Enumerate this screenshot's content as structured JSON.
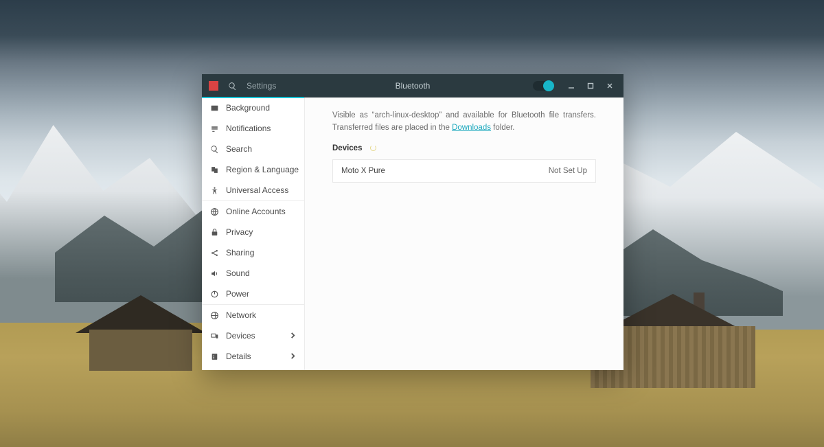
{
  "titlebar": {
    "app_title": "Settings",
    "panel_title": "Bluetooth"
  },
  "sidebar": {
    "items": [
      {
        "label": "Background"
      },
      {
        "label": "Notifications"
      },
      {
        "label": "Search"
      },
      {
        "label": "Region & Language"
      },
      {
        "label": "Universal Access"
      },
      {
        "label": "Online Accounts"
      },
      {
        "label": "Privacy"
      },
      {
        "label": "Sharing"
      },
      {
        "label": "Sound"
      },
      {
        "label": "Power"
      },
      {
        "label": "Network"
      },
      {
        "label": "Devices"
      },
      {
        "label": "Details"
      }
    ]
  },
  "bluetooth": {
    "desc_prefix": "Visible as “arch-linux-desktop” and available for Bluetooth file transfers. Transferred files are placed in the ",
    "downloads_link": "Downloads",
    "desc_suffix": " folder.",
    "devices_heading": "Devices",
    "devices": [
      {
        "name": "Moto X Pure",
        "status": "Not Set Up"
      }
    ]
  }
}
